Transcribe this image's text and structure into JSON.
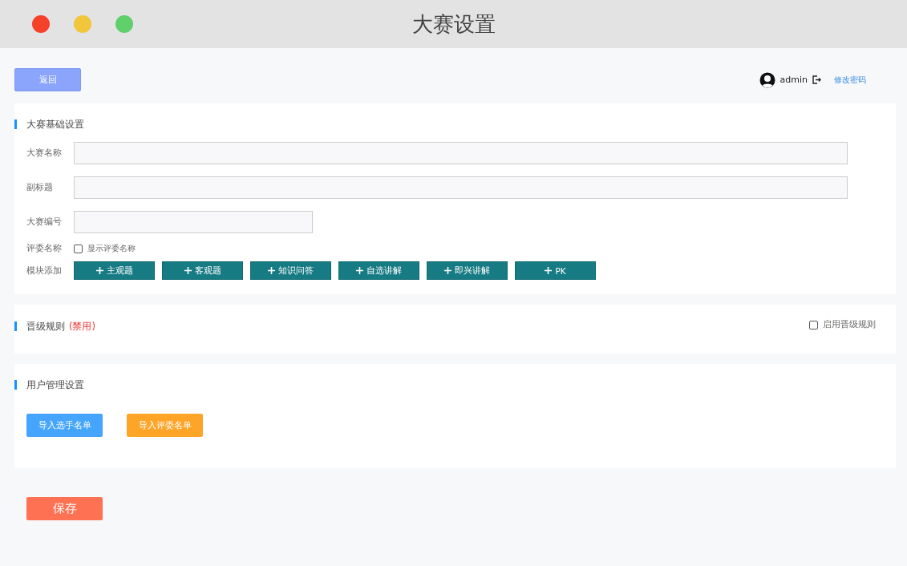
{
  "window": {
    "title": "大赛设置"
  },
  "toolbar": {
    "back_button": "返回",
    "user": {
      "name": "admin"
    },
    "change_password": "修改密码"
  },
  "basic_settings": {
    "title": "大赛基础设置",
    "rows": [
      {
        "kind": "text_long",
        "label": "大赛名称"
      },
      {
        "kind": "text_long",
        "label": "副标题"
      },
      {
        "kind": "text_short",
        "label": "大赛编号"
      },
      {
        "kind": "checkbox",
        "label": "评委名称",
        "option": {
          "label": "显示评委名称",
          "checked": false
        }
      },
      {
        "kind": "buttons",
        "label": "模块添加",
        "buttons": [
          "主观题",
          "客观题",
          "知识问答",
          "自选讲解",
          "即兴讲解",
          "PK"
        ]
      }
    ]
  },
  "promotion_rules": {
    "title": "晋级规则",
    "status": "(禁用)",
    "enable": {
      "label": "启用晋级规则",
      "checked": false
    }
  },
  "user_management": {
    "title": "用户管理设置",
    "buttons": [
      {
        "label": "导入选手名单",
        "kind": "primary"
      },
      {
        "label": "导入评委名单",
        "kind": "warning"
      }
    ]
  },
  "save_button": "保存"
}
